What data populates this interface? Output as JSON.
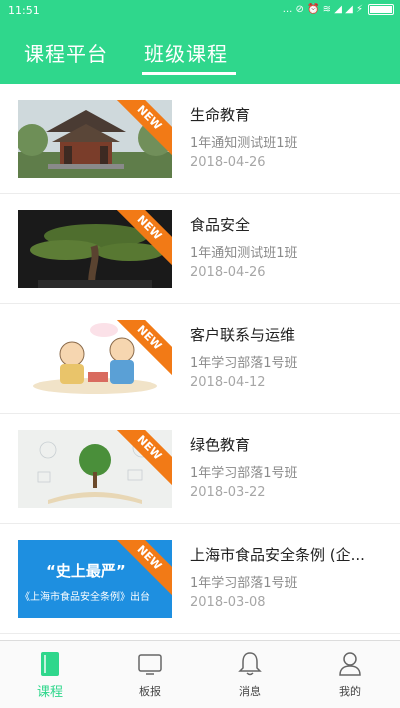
{
  "status_bar": {
    "time": "11:51",
    "indicators": "... ⊘ ⏰ ≋ ◢ ◢ ⚡"
  },
  "tabs": [
    {
      "label": "课程平台",
      "active": false
    },
    {
      "label": "班级课程",
      "active": true
    }
  ],
  "badge_label": "NEW",
  "courses": [
    {
      "title": "生命教育",
      "class_name": "1年通知测试班1班",
      "date": "2018-04-26",
      "thumb": "pavilion"
    },
    {
      "title": "食品安全",
      "class_name": "1年通知测试班1班",
      "date": "2018-04-26",
      "thumb": "bonsai"
    },
    {
      "title": "客户联系与运维",
      "class_name": "1年学习部落1号班",
      "date": "2018-04-12",
      "thumb": "cartoon"
    },
    {
      "title": "绿色教育",
      "class_name": "1年学习部落1号班",
      "date": "2018-03-22",
      "thumb": "tree-book"
    },
    {
      "title": "上海市食品安全条例 (企...",
      "class_name": "1年学习部落1号班",
      "date": "2018-03-08",
      "thumb": "banner",
      "thumb_text": {
        "line1": "“史上最严”",
        "line2": "《上海市食品安全条例》出台"
      }
    }
  ],
  "bottom_nav": [
    {
      "label": "课程",
      "icon": "book-icon",
      "active": true
    },
    {
      "label": "板报",
      "icon": "board-icon",
      "active": false
    },
    {
      "label": "消息",
      "icon": "bell-icon",
      "active": false
    },
    {
      "label": "我的",
      "icon": "user-icon",
      "active": false
    }
  ],
  "colors": {
    "primary": "#2fd78c",
    "badge": "#f27a16",
    "banner_blue": "#1e8fe0"
  }
}
